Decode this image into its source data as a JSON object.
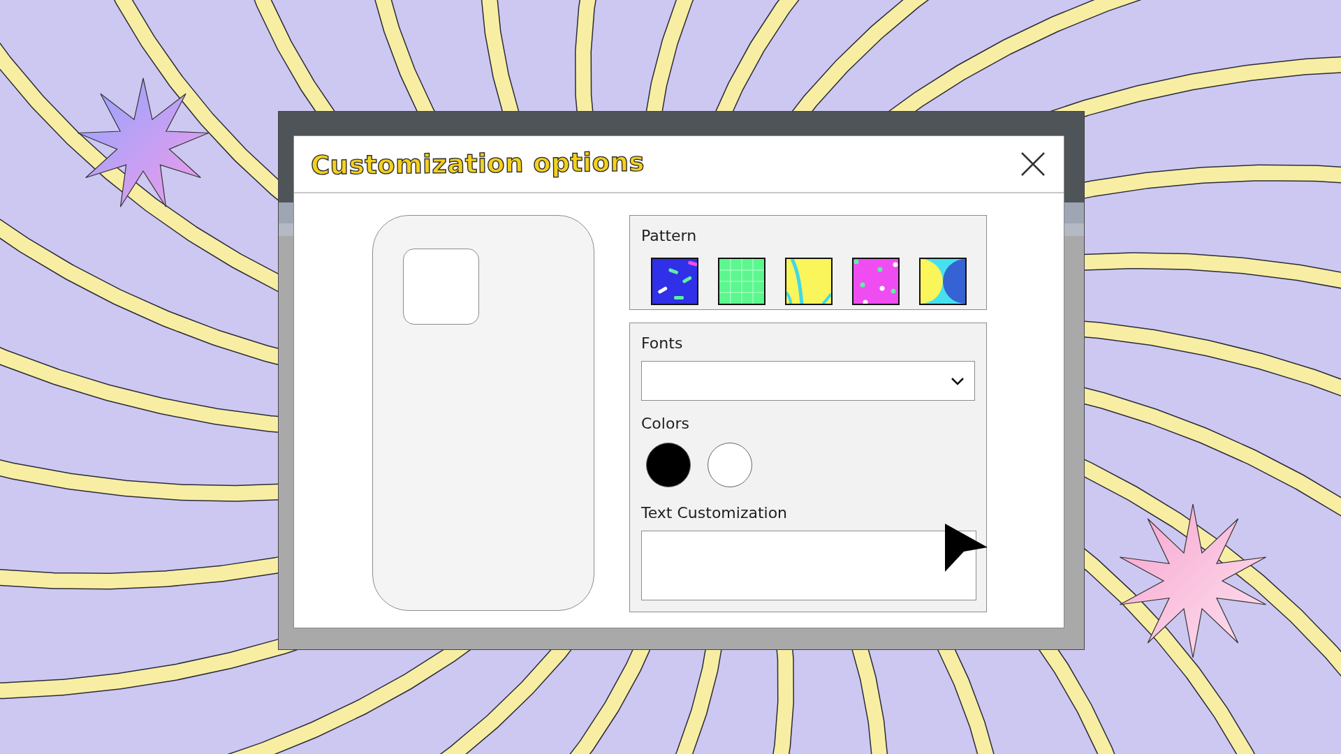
{
  "dialog": {
    "title": "Customization options"
  },
  "pattern": {
    "label": "Pattern",
    "swatches": [
      {
        "kind": "confetti"
      },
      {
        "kind": "grid"
      },
      {
        "kind": "waves"
      },
      {
        "kind": "dots"
      },
      {
        "kind": "halves"
      }
    ]
  },
  "fonts": {
    "label": "Fonts"
  },
  "colors": {
    "label": "Colors",
    "options": [
      {
        "color": "#000000"
      },
      {
        "color": "#ffffff"
      }
    ]
  },
  "text_customization": {
    "label": "Text Customization"
  }
}
